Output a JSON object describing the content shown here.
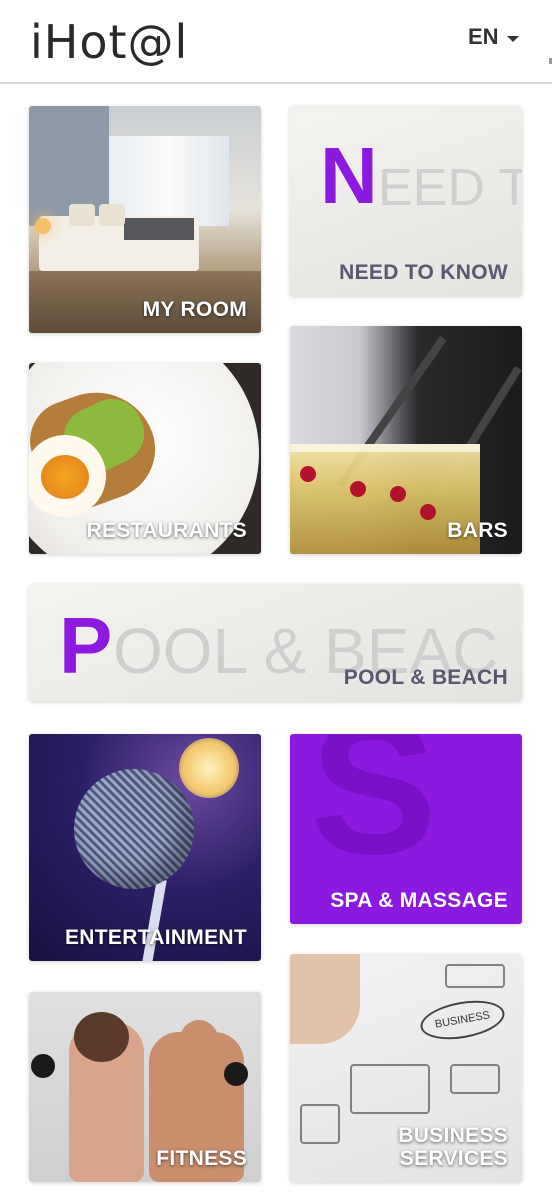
{
  "header": {
    "logo": "iHot@l",
    "language": "EN"
  },
  "tiles": {
    "my_room": {
      "label": "MY ROOM"
    },
    "need_to_know": {
      "label": "NEED TO KNOW",
      "big_letter": "N",
      "ghost_text": "EED TO"
    },
    "restaurants": {
      "label": "RESTAURANTS"
    },
    "bars": {
      "label": "BARS"
    },
    "pool_beach": {
      "label": "POOL & BEACH",
      "big_letter": "P",
      "ghost_text": "OOL & BEAC"
    },
    "entertainment": {
      "label": "ENTERTAINMENT"
    },
    "spa_massage": {
      "label": "SPA & MASSAGE",
      "big_letter": "S"
    },
    "fitness": {
      "label": "FITNESS"
    },
    "business_services": {
      "label_line1": "BUSINESS",
      "label_line2": "SERVICES",
      "sketch_text": "BUSINESS"
    }
  },
  "colors": {
    "accent_purple": "#8c19e0",
    "label_dark": "#5d5670"
  }
}
